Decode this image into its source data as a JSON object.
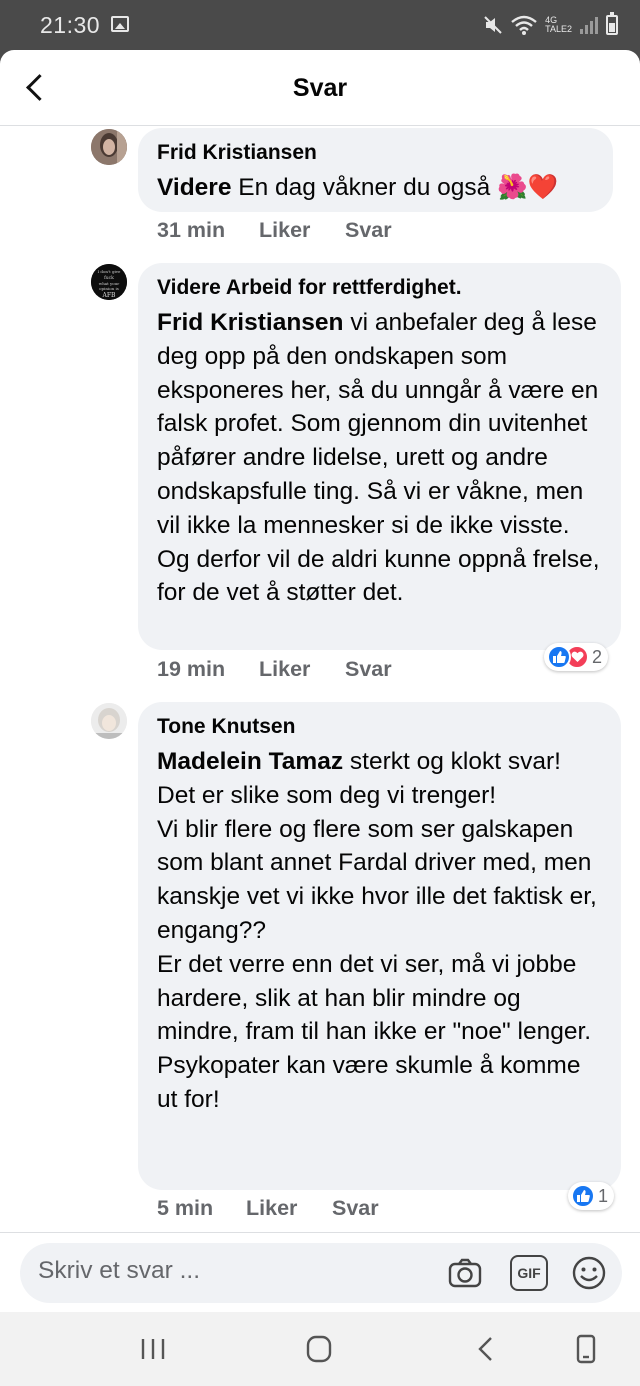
{
  "status_bar": {
    "time": "21:30",
    "network": "4G",
    "network_sub": "TALE2",
    "icons": [
      "gallery-icon",
      "mute-icon",
      "wifi-icon",
      "signal-icon",
      "battery-icon"
    ]
  },
  "header": {
    "title": "Svar"
  },
  "comments": [
    {
      "author": "Frid Kristiansen",
      "mention": "Videre",
      "text": " En dag våkner du også 🌺❤️",
      "time": "31 min",
      "like_label": "Liker",
      "reply_label": "Svar"
    },
    {
      "author": "Videre Arbeid for rettferdighet.",
      "avatar_text": "I don't give fuck what your opinion is AFB",
      "mention": "Frid Kristiansen",
      "text": " vi anbefaler deg å lese deg opp på den ondskapen som eksponeres her, så du unngår å være en falsk profet. Som gjennom din uvitenhet påfører andre lidelse,  urett og andre ondskapsfulle ting. Så vi er våkne, men vil ikke la mennesker si de ikke visste. Og derfor vil de aldri kunne oppnå frelse, for de vet å støtter det.",
      "time": "19 min",
      "like_label": "Liker",
      "reply_label": "Svar",
      "reactions": {
        "types": [
          "like",
          "love"
        ],
        "count": "2"
      }
    },
    {
      "author": "Tone Knutsen",
      "mention": "Madelein Tamaz",
      "text": " sterkt og klokt svar!\nDet er slike som deg vi trenger!\nVi blir flere og flere som ser galskapen som blant annet Fardal driver med, men kanskje vet vi ikke hvor ille det faktisk er, engang??\nEr det verre enn det vi ser, må vi jobbe hardere, slik at han blir mindre og mindre, fram til han ikke er \"noe\" lenger.\nPsykopater kan være skumle å komme ut for!",
      "time": "5 min",
      "like_label": "Liker",
      "reply_label": "Svar",
      "reactions": {
        "types": [
          "like"
        ],
        "count": "1"
      }
    }
  ],
  "composer": {
    "placeholder": "Skriv et svar ...",
    "gif_label": "GIF",
    "icons": [
      "camera-icon",
      "gif-icon",
      "emoji-icon"
    ]
  },
  "navbar": {
    "icons": [
      "recent-apps-icon",
      "home-icon",
      "back-icon",
      "accessibility-icon"
    ]
  },
  "colors": {
    "bubble": "#f0f2f5",
    "like": "#1877f2",
    "love": "#f33e58",
    "meta_text": "#65676b"
  }
}
